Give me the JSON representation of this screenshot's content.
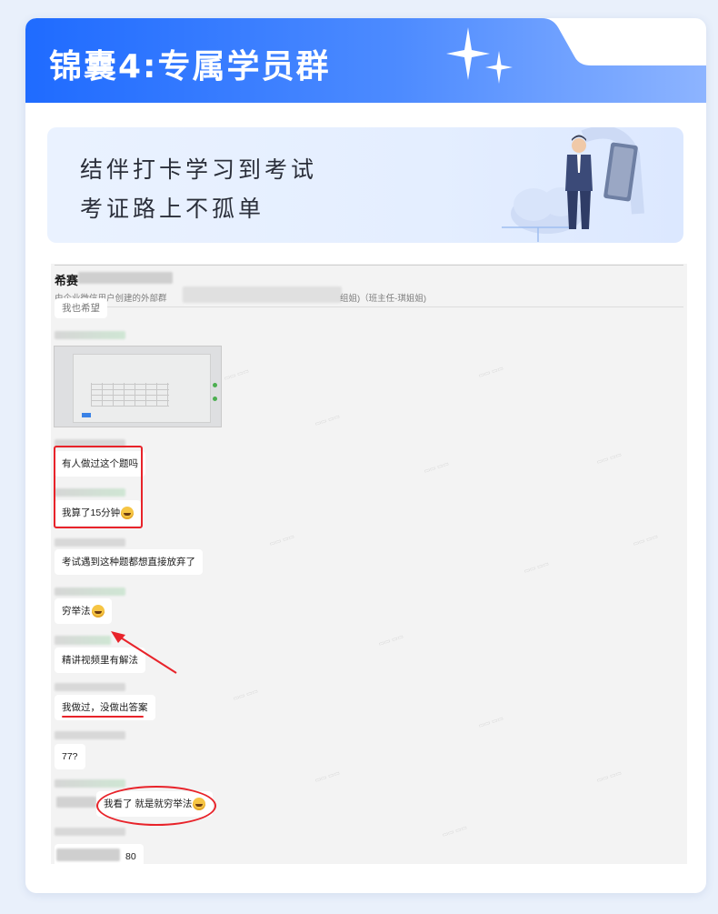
{
  "header": {
    "title": "锦囊4:专属学员群",
    "accent_color": "#1f6bff",
    "sparkle_icon": "four-point-star"
  },
  "banner": {
    "line1": "结伴打卡学习到考试",
    "line2": "考证路上不孤单",
    "illustration": "businessman-with-laptop-and-cloud"
  },
  "chat": {
    "group_name": "希赛",
    "subtitle": "由企业微信用户创建的外部群",
    "subtitle_tail": "组姐)（班主任-琪姐姐)",
    "partial_top_message": "我也希望",
    "messages": [
      {
        "text": "有人做过这个题吗",
        "emoji": false
      },
      {
        "text": "我算了15分钟",
        "emoji": true
      },
      {
        "text": "考试遇到这种题都想直接放弃了",
        "emoji": false
      },
      {
        "text": "穷举法",
        "emoji": true
      },
      {
        "text": "精讲视频里有解法",
        "emoji": false
      },
      {
        "text": "我做过，没做出答案",
        "emoji": false
      },
      {
        "text": "77?",
        "emoji": false
      },
      {
        "text": "我看了 就是就穷举法",
        "emoji": true
      },
      {
        "text": "80",
        "emoji": false
      }
    ],
    "annotation_color": "#e8232a"
  }
}
